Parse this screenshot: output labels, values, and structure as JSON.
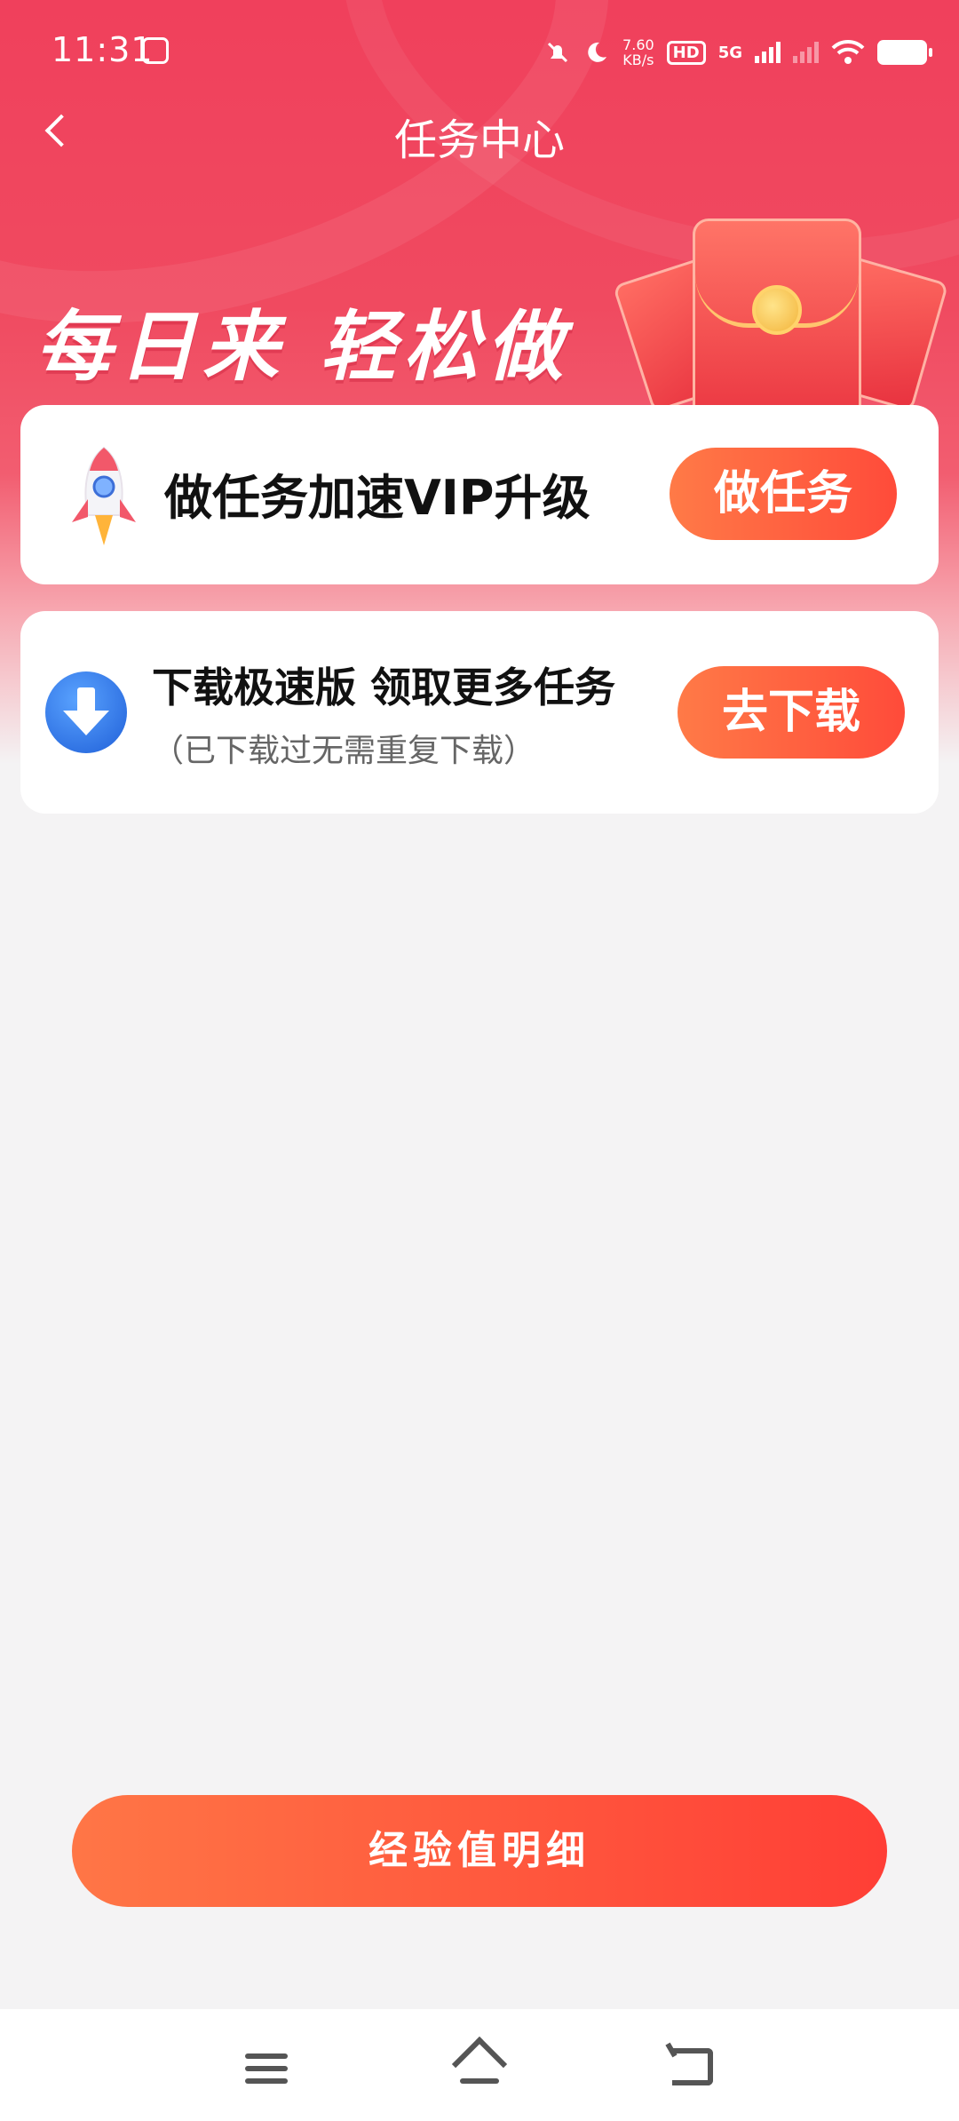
{
  "status_bar": {
    "time": "11:31",
    "net_speed_value": "7.60",
    "net_speed_unit": "KB/s",
    "hd": "HD",
    "network": "5G"
  },
  "header": {
    "title": "任务中心",
    "slogan": "每日来 轻松做"
  },
  "task_cards": [
    {
      "title": "做任务加速VIP升级",
      "button": "做任务"
    },
    {
      "title": "下载极速版 领取更多任务",
      "subtitle": "（已下载过无需重复下载）",
      "button": "去下载"
    }
  ],
  "footer": {
    "experience_button": "经验值明细"
  },
  "colors": {
    "header_red": "#f0405c",
    "button_orange": "#ff7a47",
    "button_red": "#ff4b3a",
    "page_bg": "#f4f3f4"
  },
  "icons": [
    "back-icon",
    "rocket-icon",
    "download-icon",
    "red-envelope-icon",
    "menu-icon",
    "home-icon",
    "return-icon",
    "wifi-icon",
    "battery-icon",
    "moon-icon",
    "mute-bell-icon"
  ]
}
